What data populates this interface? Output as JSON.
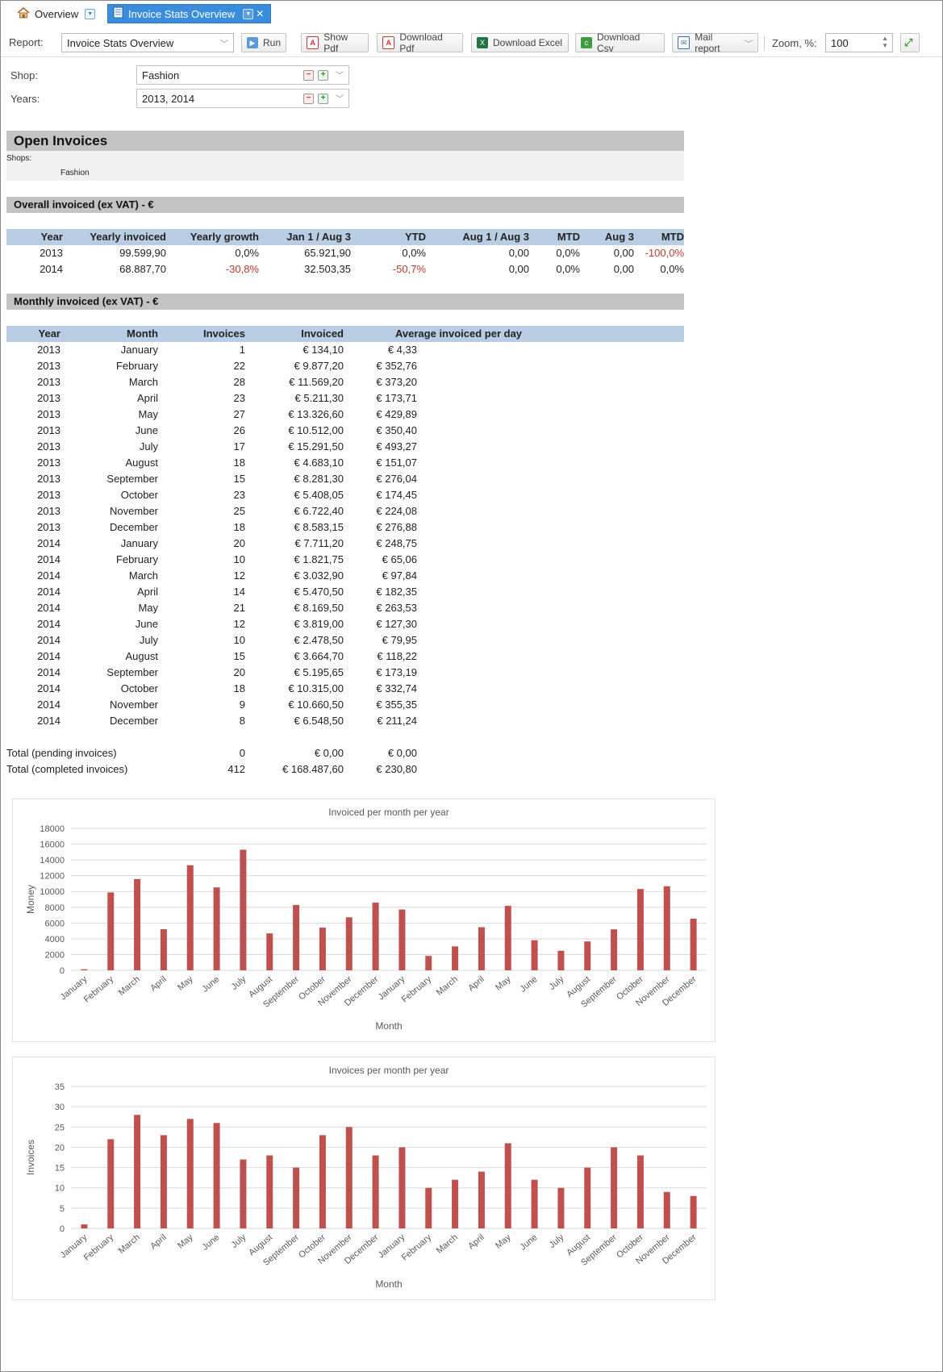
{
  "tabs": {
    "overview_label": "Overview",
    "active_label": "Invoice Stats Overview"
  },
  "toolbar": {
    "report_label": "Report:",
    "report_value": "Invoice Stats Overview",
    "run": "Run",
    "show_pdf": "Show Pdf",
    "download_pdf": "Download Pdf",
    "download_excel": "Download Excel",
    "download_csv": "Download Csv",
    "mail_report": "Mail report",
    "zoom_label": "Zoom, %:",
    "zoom_value": "100"
  },
  "filters": {
    "shop_label": "Shop:",
    "shop_value": "Fashion",
    "years_label": "Years:",
    "years_value": "2013, 2014"
  },
  "report": {
    "title": "Open Invoices",
    "shops_label": "Shops:",
    "shops_value": "Fashion",
    "overall": {
      "title": "Overall invoiced (ex VAT) - €",
      "headers": [
        "Year",
        "Yearly invoiced",
        "Yearly growth",
        "Jan 1 / Aug 3",
        "YTD",
        "Aug 1 / Aug 3",
        "MTD",
        "Aug 3",
        "MTD"
      ],
      "rows": [
        [
          "2013",
          "99.599,90",
          "0,0%",
          "65.921,90",
          "0,0%",
          "0,00",
          "0,0%",
          "0,00",
          "-100,0%"
        ],
        [
          "2014",
          "68.887,70",
          "-30,8%",
          "32.503,35",
          "-50,7%",
          "0,00",
          "0,0%",
          "0,00",
          "0,0%"
        ]
      ]
    },
    "monthly": {
      "title": "Monthly invoiced (ex VAT) - €",
      "headers": [
        "Year",
        "Month",
        "Invoices",
        "Invoiced",
        "Average invoiced per day"
      ],
      "rows": [
        [
          "2013",
          "January",
          "1",
          "€ 134,10",
          "€ 4,33"
        ],
        [
          "2013",
          "February",
          "22",
          "€ 9.877,20",
          "€ 352,76"
        ],
        [
          "2013",
          "March",
          "28",
          "€ 11.569,20",
          "€ 373,20"
        ],
        [
          "2013",
          "April",
          "23",
          "€ 5.211,30",
          "€ 173,71"
        ],
        [
          "2013",
          "May",
          "27",
          "€ 13.326,60",
          "€ 429,89"
        ],
        [
          "2013",
          "June",
          "26",
          "€ 10.512,00",
          "€ 350,40"
        ],
        [
          "2013",
          "July",
          "17",
          "€ 15.291,50",
          "€ 493,27"
        ],
        [
          "2013",
          "August",
          "18",
          "€ 4.683,10",
          "€ 151,07"
        ],
        [
          "2013",
          "September",
          "15",
          "€ 8.281,30",
          "€ 276,04"
        ],
        [
          "2013",
          "October",
          "23",
          "€ 5.408,05",
          "€ 174,45"
        ],
        [
          "2013",
          "November",
          "25",
          "€ 6.722,40",
          "€ 224,08"
        ],
        [
          "2013",
          "December",
          "18",
          "€ 8.583,15",
          "€ 276,88"
        ],
        [
          "2014",
          "January",
          "20",
          "€ 7.711,20",
          "€ 248,75"
        ],
        [
          "2014",
          "February",
          "10",
          "€ 1.821,75",
          "€ 65,06"
        ],
        [
          "2014",
          "March",
          "12",
          "€ 3.032,90",
          "€ 97,84"
        ],
        [
          "2014",
          "April",
          "14",
          "€ 5.470,50",
          "€ 182,35"
        ],
        [
          "2014",
          "May",
          "21",
          "€ 8.169,50",
          "€ 263,53"
        ],
        [
          "2014",
          "June",
          "12",
          "€ 3.819,00",
          "€ 127,30"
        ],
        [
          "2014",
          "July",
          "10",
          "€ 2.478,50",
          "€ 79,95"
        ],
        [
          "2014",
          "August",
          "15",
          "€ 3.664,70",
          "€ 118,22"
        ],
        [
          "2014",
          "September",
          "20",
          "€ 5.195,65",
          "€ 173,19"
        ],
        [
          "2014",
          "October",
          "18",
          "€ 10.315,00",
          "€ 332,74"
        ],
        [
          "2014",
          "November",
          "9",
          "€ 10.660,50",
          "€ 355,35"
        ],
        [
          "2014",
          "December",
          "8",
          "€ 6.548,50",
          "€ 211,24"
        ]
      ],
      "totals": [
        [
          "Total (pending invoices)",
          "0",
          "€ 0,00",
          "€ 0,00"
        ],
        [
          "Total (completed invoices)",
          "412",
          "€ 168.487,60",
          "€ 230,80"
        ]
      ]
    }
  },
  "chart_data": [
    {
      "type": "bar",
      "title": "Invoiced per month per year",
      "xlabel": "Month",
      "ylabel": "Money",
      "ylim": [
        0,
        18000
      ],
      "yticks": [
        0,
        2000,
        4000,
        6000,
        8000,
        10000,
        12000,
        14000,
        16000,
        18000
      ],
      "grid": true,
      "color": "#c0504d",
      "categories": [
        "January",
        "February",
        "March",
        "April",
        "May",
        "June",
        "July",
        "August",
        "September",
        "October",
        "November",
        "December",
        "January",
        "February",
        "March",
        "April",
        "May",
        "June",
        "July",
        "August",
        "September",
        "October",
        "November",
        "December"
      ],
      "values": [
        134.1,
        9877.2,
        11569.2,
        5211.3,
        13326.6,
        10512.0,
        15291.5,
        4683.1,
        8281.3,
        5408.05,
        6722.4,
        8583.15,
        7711.2,
        1821.75,
        3032.9,
        5470.5,
        8169.5,
        3819.0,
        2478.5,
        3664.7,
        5195.65,
        10315.0,
        10660.5,
        6548.5
      ]
    },
    {
      "type": "bar",
      "title": "Invoices per month per year",
      "xlabel": "Month",
      "ylabel": "Invoices",
      "ylim": [
        0,
        35
      ],
      "yticks": [
        0,
        5,
        10,
        15,
        20,
        25,
        30,
        35
      ],
      "grid": true,
      "color": "#c0504d",
      "categories": [
        "January",
        "February",
        "March",
        "April",
        "May",
        "June",
        "July",
        "August",
        "September",
        "October",
        "November",
        "December",
        "January",
        "February",
        "March",
        "April",
        "May",
        "June",
        "July",
        "August",
        "September",
        "October",
        "November",
        "December"
      ],
      "values": [
        1,
        22,
        28,
        23,
        27,
        26,
        17,
        18,
        15,
        23,
        25,
        18,
        20,
        10,
        12,
        14,
        21,
        12,
        10,
        15,
        20,
        18,
        9,
        8
      ]
    }
  ]
}
